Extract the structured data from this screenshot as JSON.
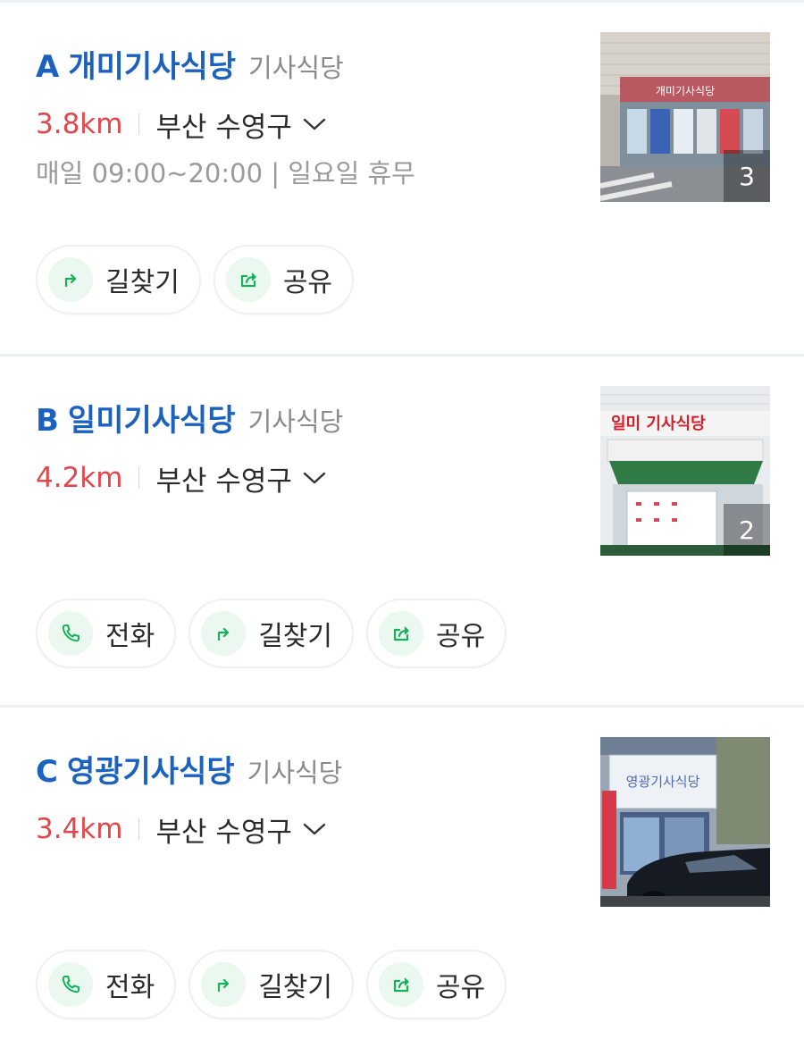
{
  "places": [
    {
      "letter": "A",
      "name": "개미기사식당",
      "category": "기사식당",
      "distance": "3.8km",
      "region": "부산 수영구",
      "hours": "매일 09:00~20:00 | 일요일 휴무",
      "photo_count": "3",
      "sign_text": "개미기사식당",
      "actions": [
        {
          "label": "길찾기",
          "icon": "directions-icon"
        },
        {
          "label": "공유",
          "icon": "share-icon"
        }
      ]
    },
    {
      "letter": "B",
      "name": "일미기사식당",
      "category": "기사식당",
      "distance": "4.2km",
      "region": "부산 수영구",
      "photo_count": "2",
      "sign_text": "일미 기사식당",
      "actions": [
        {
          "label": "전화",
          "icon": "phone-icon"
        },
        {
          "label": "길찾기",
          "icon": "directions-icon"
        },
        {
          "label": "공유",
          "icon": "share-icon"
        }
      ]
    },
    {
      "letter": "C",
      "name": "영광기사식당",
      "category": "기사식당",
      "distance": "3.4km",
      "region": "부산 수영구",
      "sign_text": "영광기사식당",
      "actions": [
        {
          "label": "전화",
          "icon": "phone-icon"
        },
        {
          "label": "길찾기",
          "icon": "directions-icon"
        },
        {
          "label": "공유",
          "icon": "share-icon"
        }
      ]
    }
  ],
  "colors": {
    "accent_blue": "#1b62bf",
    "distance_red": "#e0474c",
    "action_green": "#17b15a"
  }
}
